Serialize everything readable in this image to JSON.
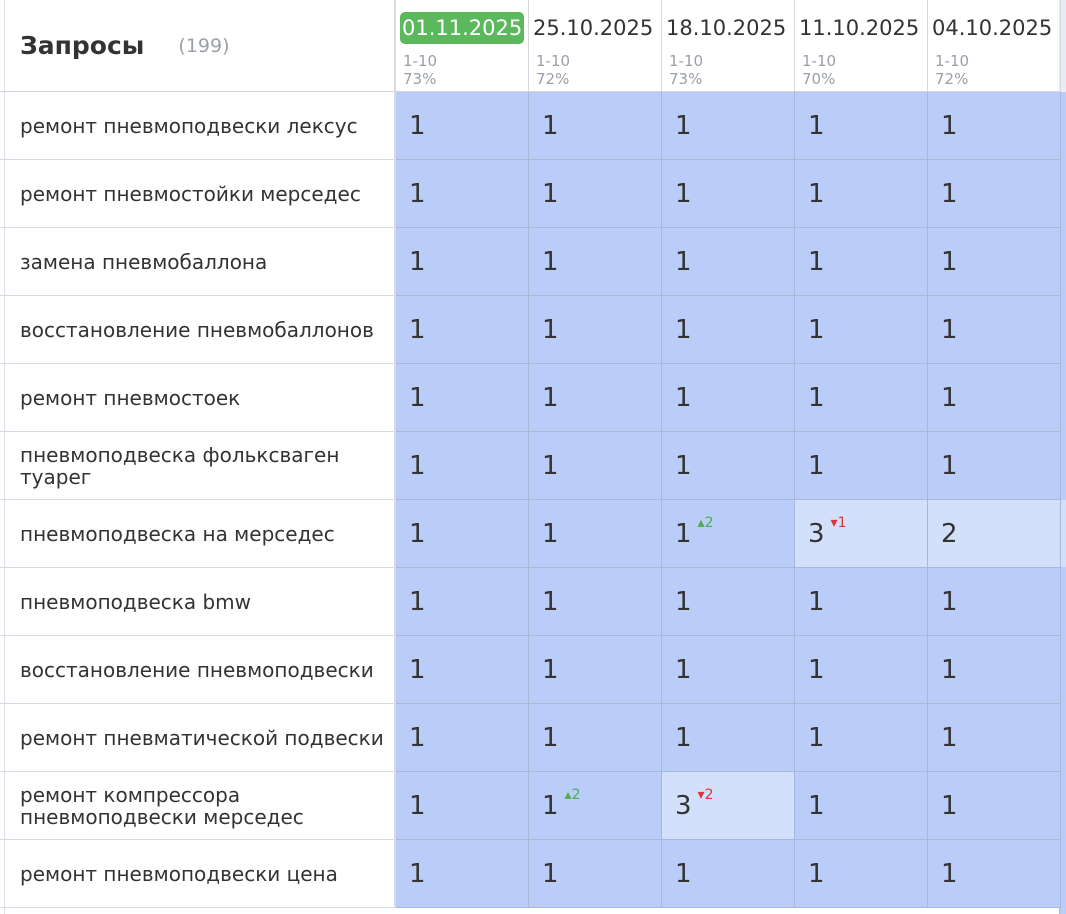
{
  "header": {
    "title": "Запросы",
    "count": "(199)",
    "columns": [
      {
        "date": "01.11.2025",
        "range": "1-10",
        "pct": "73%",
        "active": true
      },
      {
        "date": "25.10.2025",
        "range": "1-10",
        "pct": "72%",
        "active": false
      },
      {
        "date": "18.10.2025",
        "range": "1-10",
        "pct": "73%",
        "active": false
      },
      {
        "date": "11.10.2025",
        "range": "1-10",
        "pct": "70%",
        "active": false
      },
      {
        "date": "04.10.2025",
        "range": "1-10",
        "pct": "72%",
        "active": false
      }
    ]
  },
  "rows": [
    {
      "query": "ремонт пневмоподвески лексус",
      "cells": [
        {
          "v": "1"
        },
        {
          "v": "1"
        },
        {
          "v": "1"
        },
        {
          "v": "1"
        },
        {
          "v": "1"
        }
      ]
    },
    {
      "query": "ремонт пневмостойки мерседес",
      "cells": [
        {
          "v": "1"
        },
        {
          "v": "1"
        },
        {
          "v": "1"
        },
        {
          "v": "1"
        },
        {
          "v": "1"
        }
      ]
    },
    {
      "query": "замена пневмобаллона",
      "cells": [
        {
          "v": "1"
        },
        {
          "v": "1"
        },
        {
          "v": "1"
        },
        {
          "v": "1"
        },
        {
          "v": "1"
        }
      ]
    },
    {
      "query": "восстановление пневмобаллонов",
      "cells": [
        {
          "v": "1"
        },
        {
          "v": "1"
        },
        {
          "v": "1"
        },
        {
          "v": "1"
        },
        {
          "v": "1"
        }
      ]
    },
    {
      "query": "ремонт пневмостоек",
      "cells": [
        {
          "v": "1"
        },
        {
          "v": "1"
        },
        {
          "v": "1"
        },
        {
          "v": "1"
        },
        {
          "v": "1"
        }
      ]
    },
    {
      "query": "пневмоподвеска фольксваген туарег",
      "cells": [
        {
          "v": "1"
        },
        {
          "v": "1"
        },
        {
          "v": "1"
        },
        {
          "v": "1"
        },
        {
          "v": "1"
        }
      ]
    },
    {
      "query": "пневмоподвеска на мерседес",
      "cells": [
        {
          "v": "1"
        },
        {
          "v": "1"
        },
        {
          "v": "1",
          "delta": "▴2",
          "dir": "up"
        },
        {
          "v": "3",
          "delta": "▾1",
          "dir": "down",
          "light": true
        },
        {
          "v": "2",
          "light": true
        }
      ]
    },
    {
      "query": "пневмоподвеска bmw",
      "cells": [
        {
          "v": "1"
        },
        {
          "v": "1"
        },
        {
          "v": "1"
        },
        {
          "v": "1"
        },
        {
          "v": "1"
        }
      ]
    },
    {
      "query": "восстановление пневмоподвески",
      "cells": [
        {
          "v": "1"
        },
        {
          "v": "1"
        },
        {
          "v": "1"
        },
        {
          "v": "1"
        },
        {
          "v": "1"
        }
      ]
    },
    {
      "query": "ремонт пневматической подвески",
      "cells": [
        {
          "v": "1"
        },
        {
          "v": "1"
        },
        {
          "v": "1"
        },
        {
          "v": "1"
        },
        {
          "v": "1"
        }
      ]
    },
    {
      "query": "ремонт компрессора пневмоподвески мерседес",
      "cells": [
        {
          "v": "1"
        },
        {
          "v": "1",
          "delta": "▴2",
          "dir": "up"
        },
        {
          "v": "3",
          "delta": "▾2",
          "dir": "down",
          "light": true
        },
        {
          "v": "1"
        },
        {
          "v": "1"
        }
      ]
    },
    {
      "query": "ремонт пневмоподвески цена",
      "cells": [
        {
          "v": "1"
        },
        {
          "v": "1"
        },
        {
          "v": "1"
        },
        {
          "v": "1"
        },
        {
          "v": "1"
        }
      ]
    }
  ],
  "colors": {
    "cell": "#bacdf9",
    "cell_light": "#d3e0fb",
    "active_date": "#5cb85c",
    "up": "#4cae4c",
    "down": "#e03535"
  }
}
